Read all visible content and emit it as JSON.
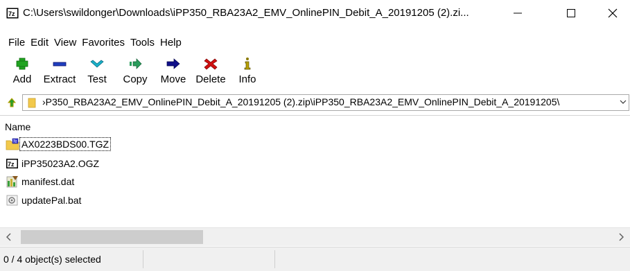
{
  "window": {
    "title": "C:\\Users\\swildonger\\Downloads\\iPP350_RBA23A2_EMV_OnlinePIN_Debit_A_20191205 (2).zi...",
    "app_icon_text": "7z"
  },
  "menu": [
    "File",
    "Edit",
    "View",
    "Favorites",
    "Tools",
    "Help"
  ],
  "toolbar": {
    "add": "Add",
    "extract": "Extract",
    "test": "Test",
    "copy": "Copy",
    "move": "Move",
    "delete": "Delete",
    "info": "Info"
  },
  "address": {
    "path": "›P350_RBA23A2_EMV_OnlinePIN_Debit_A_20191205 (2).zip\\iPP350_RBA23A2_EMV_OnlinePIN_Debit_A_20191205\\"
  },
  "list": {
    "column_name": "Name",
    "files": [
      {
        "name": "AX0223BDS00.TGZ",
        "icon": "archive-folder-icon"
      },
      {
        "name": "iPP35023A2.OGZ",
        "icon": "7z-archive-icon"
      },
      {
        "name": "manifest.dat",
        "icon": "data-file-icon"
      },
      {
        "name": "updatePal.bat",
        "icon": "batch-file-icon"
      }
    ]
  },
  "status": {
    "selection": "0 / 4 object(s) selected"
  },
  "colors": {
    "add_green": "#1fa31f",
    "extract_blue": "#1f3fbf",
    "test_cyan": "#1ab0c8",
    "copy_green": "#2a9d5c",
    "move_navy": "#10108a",
    "delete_red": "#d01010",
    "info_olive": "#8a7a00",
    "folder_yellow": "#f2c94c"
  }
}
